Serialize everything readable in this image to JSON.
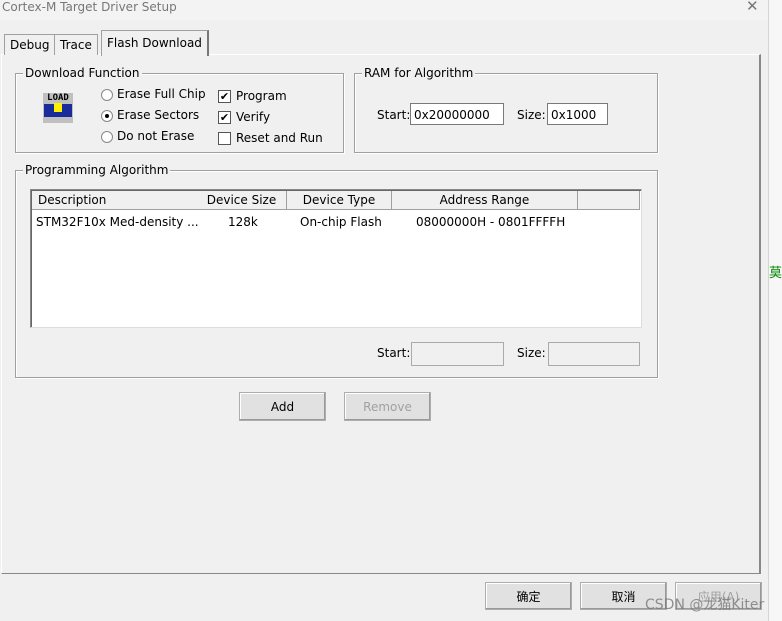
{
  "window": {
    "title": "Cortex-M Target Driver Setup",
    "close": "✕"
  },
  "tabs": [
    {
      "label": "Debug"
    },
    {
      "label": "Trace"
    },
    {
      "label": "Flash Download",
      "selected": true
    }
  ],
  "download_function": {
    "label": "Download Function",
    "icon": "load-icon",
    "icon_text": "LOAD",
    "radios": [
      {
        "label": "Erase Full Chip",
        "checked": false
      },
      {
        "label": "Erase Sectors",
        "checked": true
      },
      {
        "label": "Do not Erase",
        "checked": false
      }
    ],
    "checkboxes": [
      {
        "label": "Program",
        "checked": true
      },
      {
        "label": "Verify",
        "checked": true
      },
      {
        "label": "Reset and Run",
        "checked": false
      }
    ]
  },
  "ram": {
    "label": "RAM for Algorithm",
    "start_label": "Start:",
    "start": "0x20000000",
    "size_label": "Size:",
    "size": "0x1000"
  },
  "algorithm": {
    "label": "Programming Algorithm",
    "columns": [
      "Description",
      "Device Size",
      "Device Type",
      "Address Range",
      ""
    ],
    "rows": [
      {
        "description": "STM32F10x Med-density ...",
        "size": "128k",
        "type": "On-chip Flash",
        "range": "08000000H - 0801FFFFH"
      }
    ],
    "start_label": "Start:",
    "start": "",
    "size_label": "Size:",
    "size": ""
  },
  "buttons": {
    "add": "Add",
    "remove": "Remove",
    "ok": "确定",
    "cancel": "取消",
    "apply": "应用(A)"
  },
  "background_text": "莫",
  "watermark": "CSDN @龙猫Kiter"
}
